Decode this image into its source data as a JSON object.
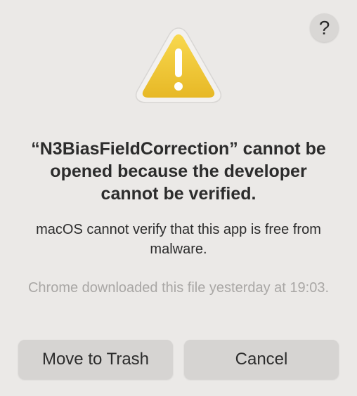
{
  "dialog": {
    "help_label": "?",
    "icon": "warning-triangle-icon",
    "title": "“N3BiasFieldCorrection” cannot be opened because the developer cannot be verified.",
    "message": "macOS cannot verify that this app is free from malware.",
    "info": "Chrome downloaded this file yesterday at 19:03.",
    "buttons": {
      "move_to_trash": "Move to Trash",
      "cancel": "Cancel"
    }
  },
  "colors": {
    "background": "#ebe9e7",
    "button": "#d6d4d2",
    "warning_yellow": "#f2c538",
    "warning_border": "#e6e4e2",
    "secondary_text": "#a9a7a5"
  }
}
